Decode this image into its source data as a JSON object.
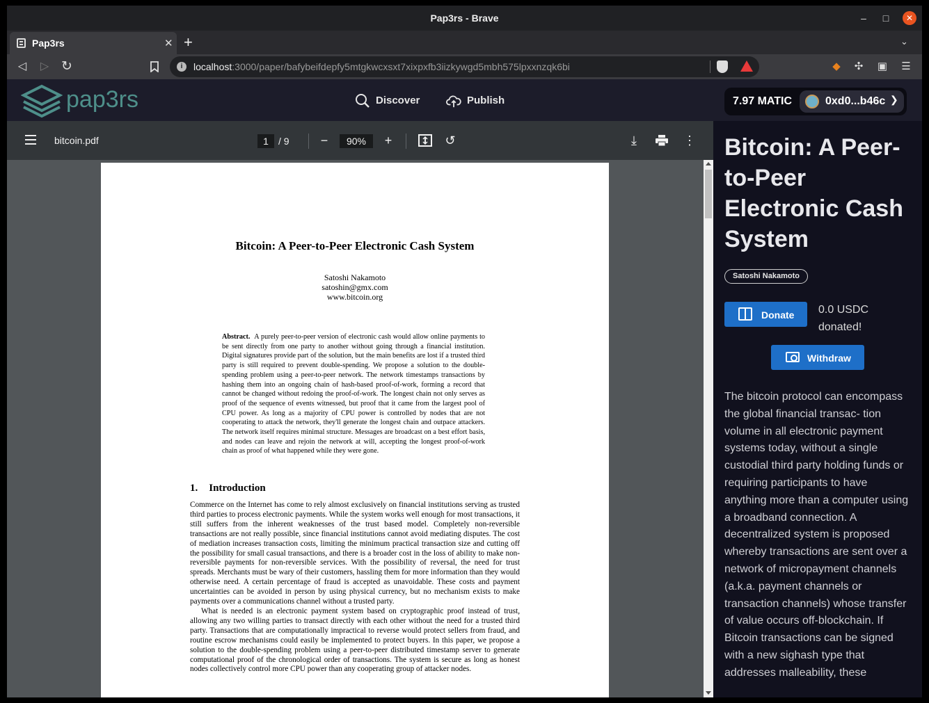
{
  "browser": {
    "window_title": "Pap3rs - Brave",
    "window_controls": {
      "minimize": "–",
      "maximize": "□",
      "close": "✕"
    },
    "tab": {
      "title": "Pap3rs",
      "close": "✕"
    },
    "new_tab": "+",
    "tab_menu": "⌄",
    "url_host": "localhost",
    "url_rest": ":3000/paper/bafybeifdepfy5mtgkwcxsxt7xixpxfb3iizkywgd5mbh575lpxxnzqk6bi",
    "icons": [
      "back-icon",
      "forward-icon",
      "reload-icon",
      "bookmark-icon",
      "site-info-icon",
      "brave-shields-icon",
      "brave-rewards-icon",
      "metamask-icon",
      "extensions-icon",
      "wallet-icon",
      "menu-icon"
    ]
  },
  "app": {
    "logo_text": "pap3rs",
    "nav": {
      "discover": "Discover",
      "publish": "Publish"
    },
    "balance": "7.97 MATIC",
    "account": "0xd0...b46c"
  },
  "pdf": {
    "filename": "bitcoin.pdf",
    "page_current": "1",
    "page_total": "/ 9",
    "zoom": "90%",
    "title": "Bitcoin: A Peer-to-Peer Electronic Cash System",
    "author_lines": [
      "Satoshi Nakamoto",
      "satoshin@gmx.com",
      "www.bitcoin.org"
    ],
    "abstract_label": "Abstract.",
    "abstract": "A purely peer-to-peer version of electronic cash would allow online payments to be sent directly from one party to another without going through a financial institution. Digital signatures provide part of the solution, but the main benefits are lost if a trusted third party is still required to prevent double-spending. We propose a solution to the double-spending problem using a peer-to-peer network. The network timestamps transactions by hashing them into an ongoing chain of hash-based proof-of-work, forming a record that cannot be changed without redoing the proof-of-work. The longest chain not only serves as proof of the sequence of events witnessed, but proof that it came from the largest pool of CPU power. As long as a majority of CPU power is controlled by nodes that are not cooperating to attack the network, they'll generate the longest chain and outpace attackers. The network itself requires minimal structure. Messages are broadcast on a best effort basis, and nodes can leave and rejoin the network at will, accepting the longest proof-of-work chain as proof of what happened while they were gone.",
    "section_number": "1.",
    "section_title": "Introduction",
    "intro_p1": "Commerce on the Internet has come to rely almost exclusively on financial institutions serving as trusted third parties to process electronic payments. While the system works well enough for most transactions, it still suffers from the inherent weaknesses of the trust based model. Completely non-reversible transactions are not really possible, since financial institutions cannot avoid mediating disputes. The cost of mediation increases transaction costs, limiting the minimum practical transaction size and cutting off the possibility for small casual transactions, and there is a broader cost in the loss of ability to make non-reversible payments for non-reversible services. With the possibility of reversal, the need for trust spreads. Merchants must be wary of their customers, hassling them for more information than they would otherwise need. A certain percentage of fraud is accepted as unavoidable. These costs and payment uncertainties can be avoided in person by using physical currency, but no mechanism exists to make payments over a communications channel without a trusted party.",
    "intro_p2": "What is needed is an electronic payment system based on cryptographic proof instead of trust, allowing any two willing parties to transact directly with each other without the need for a trusted third party. Transactions that are computationally impractical to reverse would protect sellers from fraud, and routine escrow mechanisms could easily be implemented to protect buyers. In this paper, we propose a solution to the double-spending problem using a peer-to-peer distributed timestamp server to generate computational proof of the chronological order of transactions. The system is secure as long as honest nodes collectively control more CPU power than any cooperating group of attacker nodes."
  },
  "details": {
    "title": "Bitcoin: A Peer-to-Peer Electronic Cash System",
    "author": "Satoshi Nakamoto",
    "donate_label": "Donate",
    "donated_text": "0.0 USDC donated!",
    "withdraw_label": "Withdraw",
    "abstract": "The bitcoin protocol can encompass the global financial transac- tion volume in all electronic payment systems today, without a single custodial third party holding funds or requiring participants to have anything more than a computer using a broadband connection. A decentralized system is proposed whereby transactions are sent over a network of micropayment channels (a.k.a. payment channels or transaction channels) whose transfer of value occurs off-blockchain. If Bitcoin transactions can be signed with a new sighash type that addresses malleability, these transfers may occur between"
  },
  "colors": {
    "accent": "#1e6fc8",
    "app_header_bg": "#1c1c2a",
    "details_bg": "#11111e",
    "logo": "#4e8f8a",
    "pdf_bg": "#525659"
  }
}
